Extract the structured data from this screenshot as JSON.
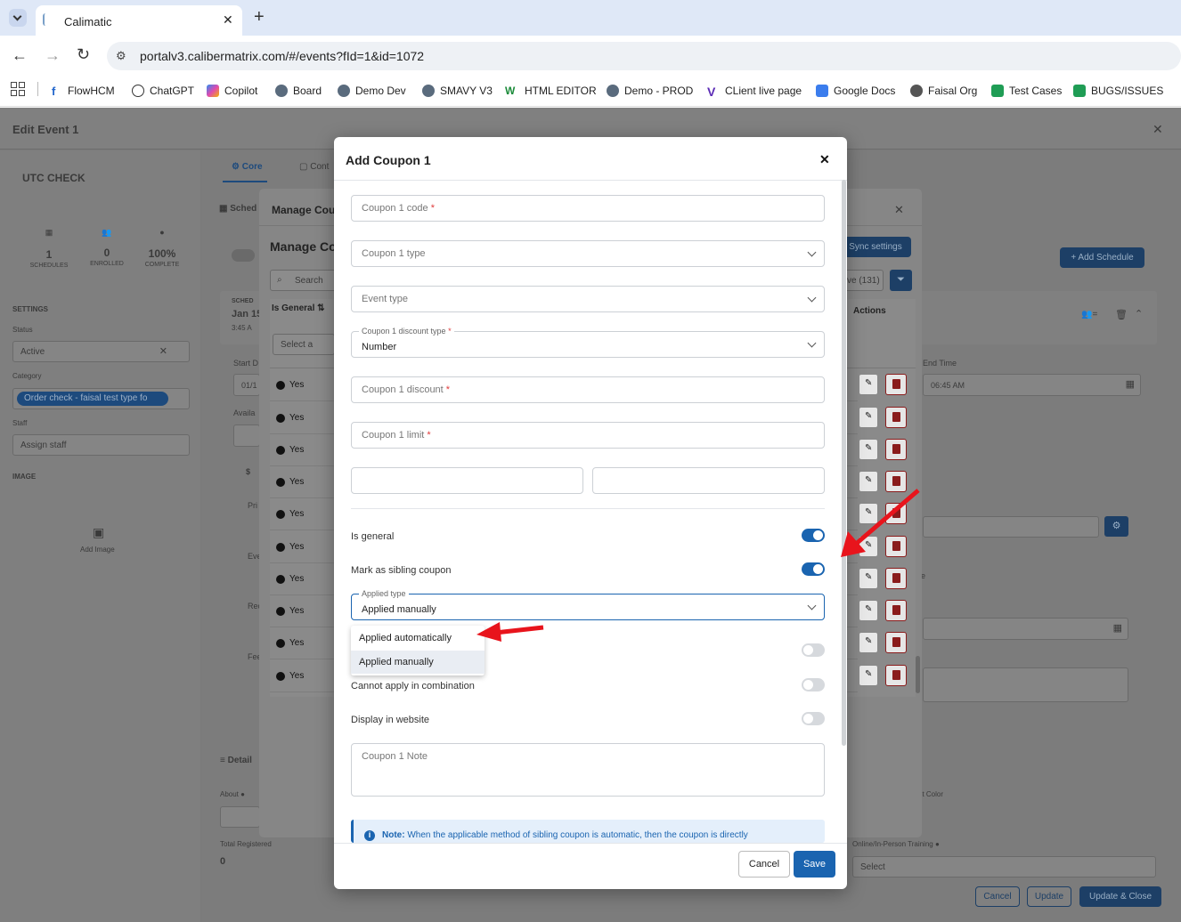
{
  "browser": {
    "tab_title": "Calimatic",
    "url": "portalv3.calibermatrix.com/#/events?fId=1&id=1072",
    "bookmarks": [
      "FlowHCM",
      "ChatGPT",
      "Copilot",
      "Board",
      "Demo Dev",
      "SMAVY V3",
      "HTML EDITOR",
      "Demo - PROD",
      "CLient live page",
      "Google Docs",
      "Faisal Org",
      "Test Cases",
      "BUGS/ISSUES"
    ]
  },
  "event": {
    "header_title": "Edit Event 1",
    "name": "UTC CHECK",
    "stats": [
      {
        "value": "1",
        "label": "SCHEDULES"
      },
      {
        "value": "0",
        "label": "ENROLLED"
      },
      {
        "value": "100%",
        "label": "COMPLETE"
      }
    ],
    "settings_label": "SETTINGS",
    "status_label": "Status",
    "status_value": "Active",
    "category_label": "Category",
    "category_value": "Order check - faisal test type fo",
    "staff_label": "Staff",
    "staff_placeholder": "Assign staff",
    "image_label": "IMAGE",
    "add_image": "Add Image",
    "tab_core": "Core",
    "tab_cont": "Cont",
    "sched_label": "Sched",
    "add_schedule": "+ Add Schedule",
    "sched_header": "SCHED",
    "sched_date": "Jan 15",
    "sched_time": "3:45 A",
    "start_label": "Start D",
    "start_value": "01/1",
    "avail_label": "Availa",
    "end_time_label": "End Time",
    "end_time_value": "06:45 AM",
    "details_label": "Detail",
    "about_label": "About",
    "total_registered_label": "Total Registered",
    "total_registered_value": "0",
    "online_label": "Online/In-Person Training",
    "online_select": "Select",
    "nt_color": "nt Color",
    "cancel": "Cancel",
    "update": "Update",
    "update_close": "Update & Close",
    "side_labels": [
      "$",
      "Pri",
      "Eve",
      "Rec",
      "Fee"
    ],
    "e_label": "e"
  },
  "manage": {
    "title": "Manage Cou",
    "subtitle": "Manage Co",
    "sync": "Sync settings",
    "search_placeholder": "Search",
    "inactive": "ve (131)",
    "col_general": "Is General",
    "col_actions": "Actions",
    "select_placeholder": "Select a",
    "rows": [
      "Yes",
      "Yes",
      "Yes",
      "Yes",
      "Yes",
      "Yes",
      "Yes",
      "Yes",
      "Yes",
      "Yes"
    ]
  },
  "modal": {
    "title": "Add Coupon 1",
    "code_placeholder": "Coupon 1 code",
    "type_placeholder": "Coupon 1 type",
    "event_type_placeholder": "Event type",
    "discount_type_label": "Coupon 1 discount type",
    "discount_type_value": "Number",
    "discount_placeholder": "Coupon 1 discount",
    "limit_placeholder": "Coupon 1 limit",
    "is_general": "Is general",
    "is_general_on": true,
    "sibling": "Mark as sibling coupon",
    "sibling_on": true,
    "applied_type_label": "Applied type",
    "applied_type_value": "Applied manually",
    "dropdown_options": [
      "Applied automatically",
      "Applied manually"
    ],
    "combination": "Cannot apply in combination",
    "website": "Display in website",
    "note_placeholder": "Coupon 1 Note",
    "note_bold": "Note:",
    "note_text": "When the applicable method of sibling coupon is automatic, then the coupon is directly",
    "cancel": "Cancel",
    "save": "Save",
    "required_mark": "*"
  },
  "colors": {
    "primary": "#1a64b0",
    "danger": "#e03b3b",
    "annotation": "#e8141c"
  }
}
